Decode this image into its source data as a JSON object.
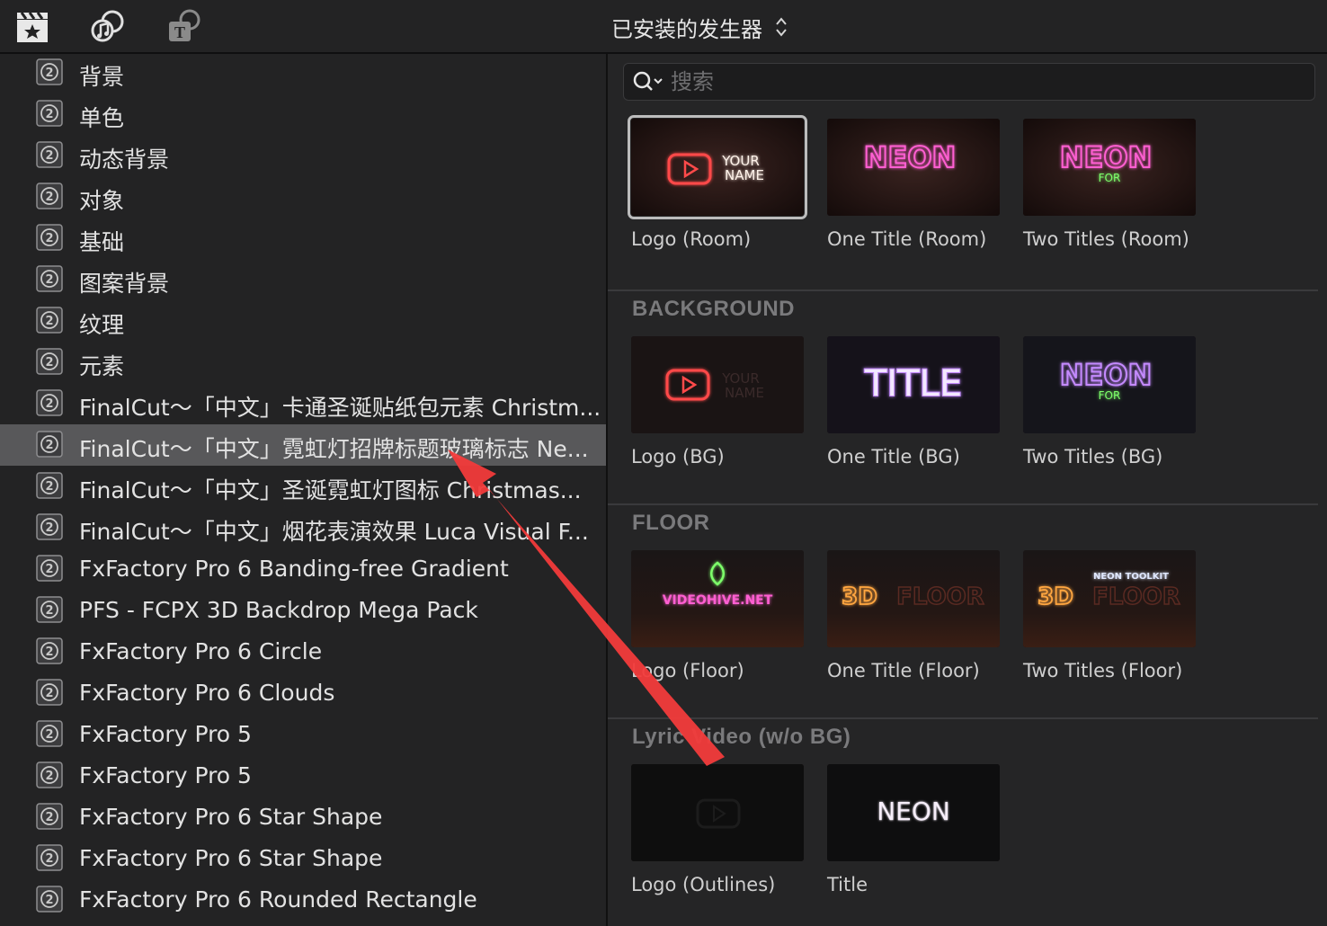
{
  "toolbar": {
    "icons": [
      "clapper-star-icon",
      "photos-music-icon",
      "titles-generators-icon"
    ],
    "browser_title": "已安装的发生器"
  },
  "sidebar": {
    "selected_index": 9,
    "items": [
      "背景",
      "单色",
      "动态背景",
      "对象",
      "基础",
      "图案背景",
      "纹理",
      "元素",
      "FinalCut～「中文」卡通圣诞贴纸包元素 Christm...",
      "FinalCut～「中文」霓虹灯招牌标题玻璃标志 Ne...",
      "FinalCut～「中文」圣诞霓虹灯图标 Christmas...",
      "FinalCut～「中文」烟花表演效果 Luca Visual F...",
      "FxFactory Pro 6 Banding-free Gradient",
      "PFS - FCPX 3D Backdrop Mega Pack",
      "FxFactory Pro 6 Circle",
      "FxFactory Pro 6 Clouds",
      "FxFactory Pro 5",
      "FxFactory Pro 5",
      "FxFactory Pro 6 Star Shape",
      "FxFactory Pro 6 Star Shape",
      "FxFactory Pro 6 Rounded Rectangle"
    ]
  },
  "search": {
    "placeholder": "搜索",
    "value": ""
  },
  "sections": [
    {
      "header": "",
      "tiles": [
        {
          "label": "Logo (Room)",
          "thumb_text": "YOUR NAME",
          "style": "logo-room",
          "selected": true
        },
        {
          "label": "One Title (Room)",
          "thumb_text": "NEON",
          "style": "neon-pink"
        },
        {
          "label": "Two Titles (Room)",
          "thumb_text": "NEON",
          "thumb_sub": "FOR",
          "style": "neon-pink-green"
        }
      ]
    },
    {
      "header": "BACKGROUND",
      "tiles": [
        {
          "label": "Logo (BG)",
          "thumb_text": "YOUR NAME",
          "style": "logo-bg"
        },
        {
          "label": "One Title (BG)",
          "thumb_text": "TITLE",
          "style": "title-purple"
        },
        {
          "label": "Two Titles (BG)",
          "thumb_text": "NEON",
          "thumb_sub": "FOR",
          "style": "neon-purple-green"
        }
      ]
    },
    {
      "header": "FLOOR",
      "tiles": [
        {
          "label": "Logo (Floor)",
          "thumb_text": "VIDEOHIVE.NET",
          "style": "floor-green"
        },
        {
          "label": "One Title (Floor)",
          "thumb_text": "3D",
          "thumb_sub": "FLOOR",
          "style": "floor-3d"
        },
        {
          "label": "Two Titles (Floor)",
          "thumb_text": "3D",
          "thumb_sub": "FLOOR",
          "thumb_top": "NEON TOOLKIT",
          "style": "floor-3d-toolkit"
        }
      ]
    },
    {
      "header": "Lyric Video (w/o BG)",
      "tiles": [
        {
          "label": "Logo (Outlines)",
          "style": "outline-dark"
        },
        {
          "label": "Title",
          "thumb_text": "NEON",
          "style": "dark-neon"
        }
      ]
    }
  ],
  "colors": {
    "annotation_arrow": "#f23b3b",
    "neon_pink": "#ff5fd2",
    "neon_red": "#ff4a4a",
    "neon_green": "#7dff6a",
    "neon_purple": "#c48aff",
    "neon_orange": "#ffa640"
  }
}
